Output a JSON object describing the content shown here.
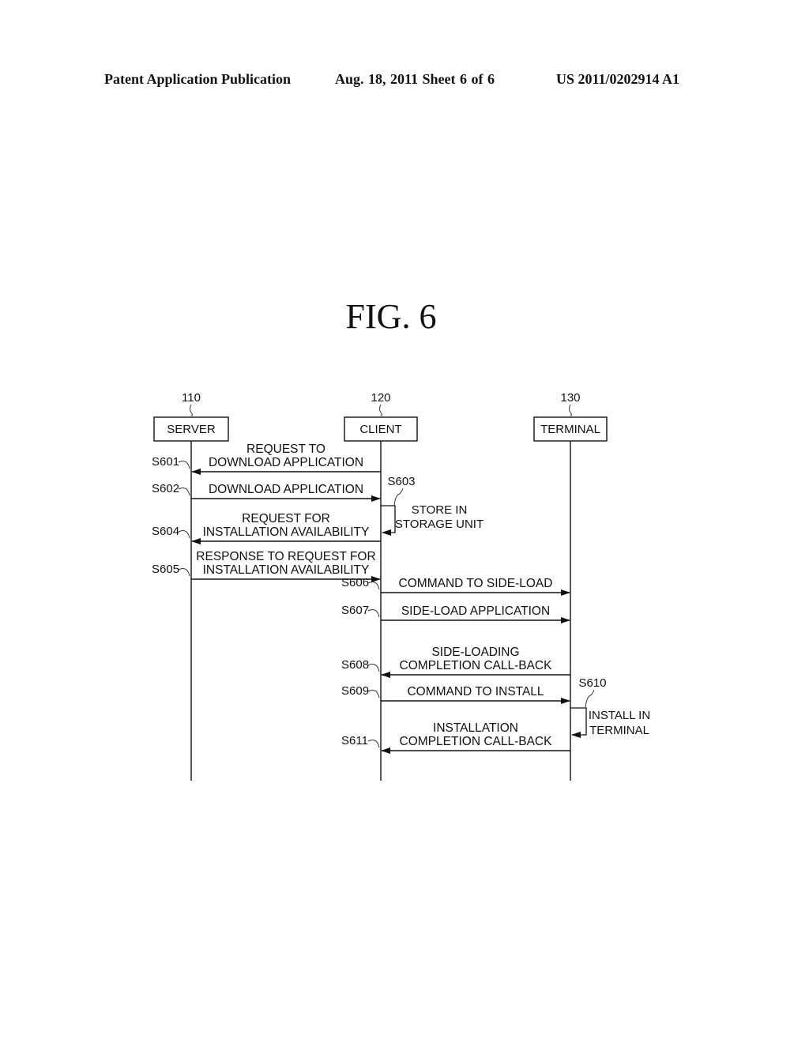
{
  "header": {
    "publication": "Patent Application Publication",
    "date_sheet": "Aug. 18, 2011   Sheet 6 of 6",
    "number": "US 2011/0202914 A1"
  },
  "figure": {
    "title": "FIG.  6"
  },
  "entities": [
    {
      "ref": "110",
      "name": "SERVER"
    },
    {
      "ref": "120",
      "name": "CLIENT"
    },
    {
      "ref": "130",
      "name": "TERMINAL"
    }
  ],
  "steps": [
    {
      "id": "S601",
      "from": "CLIENT",
      "to": "SERVER",
      "lines": [
        "REQUEST TO",
        "DOWNLOAD APPLICATION"
      ]
    },
    {
      "id": "S602",
      "from": "SERVER",
      "to": "CLIENT",
      "lines": [
        "DOWNLOAD APPLICATION"
      ]
    },
    {
      "id": "S603",
      "from": "CLIENT",
      "to": "CLIENT",
      "lines": [
        "STORE IN",
        "STORAGE UNIT"
      ]
    },
    {
      "id": "S604",
      "from": "CLIENT",
      "to": "SERVER",
      "lines": [
        "REQUEST FOR",
        "INSTALLATION AVAILABILITY"
      ]
    },
    {
      "id": "S605",
      "from": "SERVER",
      "to": "CLIENT",
      "lines": [
        "RESPONSE TO REQUEST FOR",
        "INSTALLATION AVAILABILITY"
      ]
    },
    {
      "id": "S606",
      "from": "CLIENT",
      "to": "TERMINAL",
      "lines": [
        "COMMAND TO SIDE-LOAD"
      ]
    },
    {
      "id": "S607",
      "from": "CLIENT",
      "to": "TERMINAL",
      "lines": [
        "SIDE-LOAD APPLICATION"
      ]
    },
    {
      "id": "S608",
      "from": "TERMINAL",
      "to": "CLIENT",
      "lines": [
        "SIDE-LOADING",
        "COMPLETION CALL-BACK"
      ]
    },
    {
      "id": "S609",
      "from": "CLIENT",
      "to": "TERMINAL",
      "lines": [
        "COMMAND TO INSTALL"
      ]
    },
    {
      "id": "S610",
      "from": "TERMINAL",
      "to": "TERMINAL",
      "lines": [
        "INSTALL IN",
        "TERMINAL"
      ]
    },
    {
      "id": "S611",
      "from": "TERMINAL",
      "to": "CLIENT",
      "lines": [
        "INSTALLATION",
        "COMPLETION CALL-BACK"
      ]
    }
  ]
}
